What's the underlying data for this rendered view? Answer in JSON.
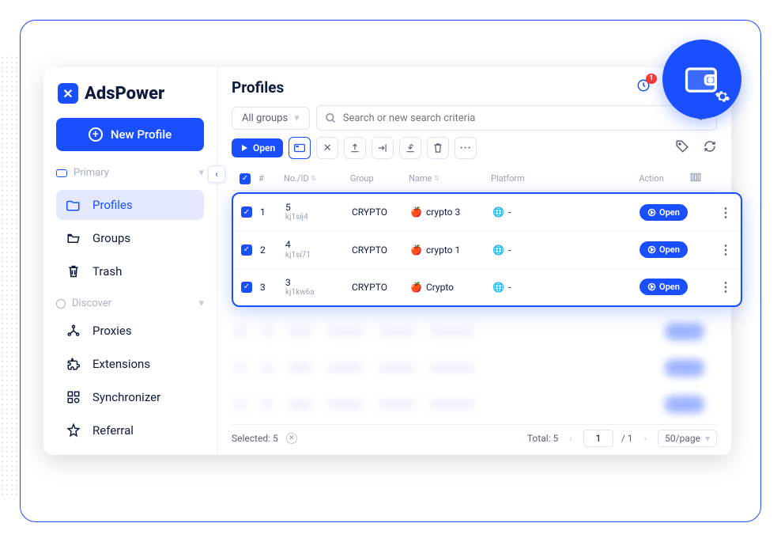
{
  "brand": "AdsPower",
  "new_profile_label": "New Profile",
  "collapse_label": "‹",
  "nav_sections": {
    "primary": {
      "label": "Primary"
    },
    "discover": {
      "label": "Discover"
    }
  },
  "nav": {
    "profiles": "Profiles",
    "groups": "Groups",
    "trash": "Trash",
    "proxies": "Proxies",
    "extensions": "Extensions",
    "synchronizer": "Synchronizer",
    "referral": "Referral"
  },
  "header": {
    "title": "Profiles",
    "notif_badge": "1",
    "bell_badge": "1"
  },
  "filters": {
    "group_selected": "All groups",
    "search_placeholder": "Search or new search criteria"
  },
  "toolbar": {
    "open_label": "Open"
  },
  "table": {
    "columns": {
      "idx": "#",
      "noid": "No./ID",
      "group": "Group",
      "name": "Name",
      "platform": "Platform",
      "action": "Action"
    },
    "rows": [
      {
        "checked": true,
        "idx": "1",
        "no": "5",
        "id": "kj1sij4",
        "group": "CRYPTO",
        "name": "crypto 3",
        "platform": "-",
        "action": "Open"
      },
      {
        "checked": true,
        "idx": "2",
        "no": "4",
        "id": "kj1si71",
        "group": "CRYPTO",
        "name": "crypto 1",
        "platform": "-",
        "action": "Open"
      },
      {
        "checked": true,
        "idx": "3",
        "no": "3",
        "id": "kj1kw6a",
        "group": "CRYPTO",
        "name": "Crypto",
        "platform": "-",
        "action": "Open"
      }
    ]
  },
  "footer": {
    "selected_label": "Selected: 5",
    "total_label": "Total: 5",
    "page": "1",
    "total_pages": "/ 1",
    "page_size": "50/page"
  }
}
